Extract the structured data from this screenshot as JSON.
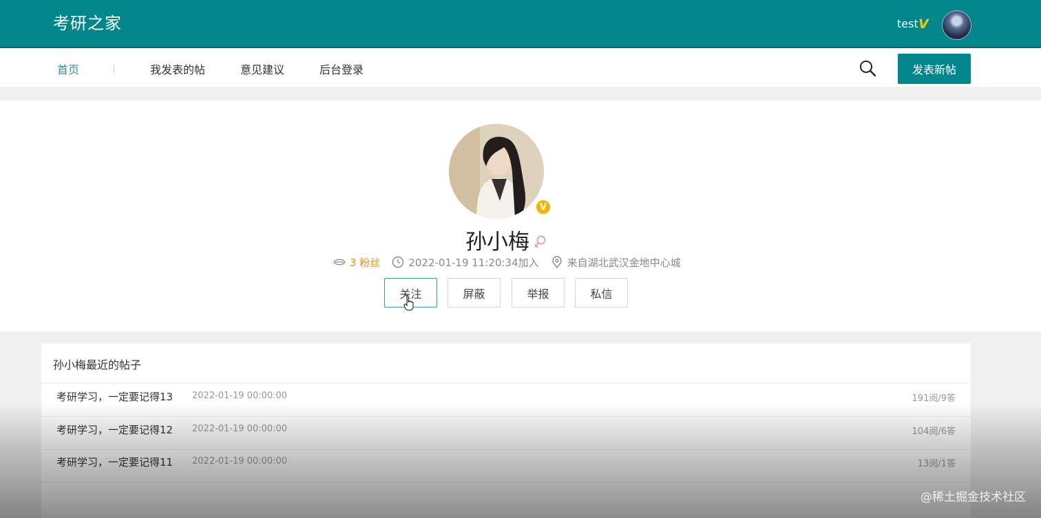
{
  "header": {
    "brand": "考研之家",
    "user_name": "test",
    "user_badge": "V"
  },
  "nav": {
    "items": [
      {
        "label": "首页",
        "active": true
      },
      {
        "label": "我发表的帖"
      },
      {
        "label": "意见建议"
      },
      {
        "label": "后台登录"
      }
    ],
    "post_button": "发表新帖",
    "search_icon": "search-icon"
  },
  "profile": {
    "name": "孙小梅",
    "verified_badge": "V",
    "gender_icon": "female-icon",
    "fans": "3 粉丝",
    "joined": "2022-01-19 11:20:34加入",
    "location": "来自湖北武汉金地中心城",
    "actions": {
      "follow": "关注",
      "block": "屏蔽",
      "report": "举报",
      "message": "私信"
    }
  },
  "posts": {
    "title": "孙小梅最近的帖子",
    "rows": [
      {
        "title": "考研学习，一定要记得13",
        "date": "2022-01-19 00:00:00",
        "stats": "191阅/9答"
      },
      {
        "title": "考研学习，一定要记得12",
        "date": "2022-01-19 00:00:00",
        "stats": "104阅/6答"
      },
      {
        "title": "考研学习，一定要记得11",
        "date": "2022-01-19 00:00:00",
        "stats": "13阅/1答"
      }
    ]
  },
  "watermark": "@稀土掘金技术社区",
  "colors": {
    "primary": "#00868b",
    "accent_orange": "#e88f1f",
    "badge_gold": "#f5b400"
  }
}
